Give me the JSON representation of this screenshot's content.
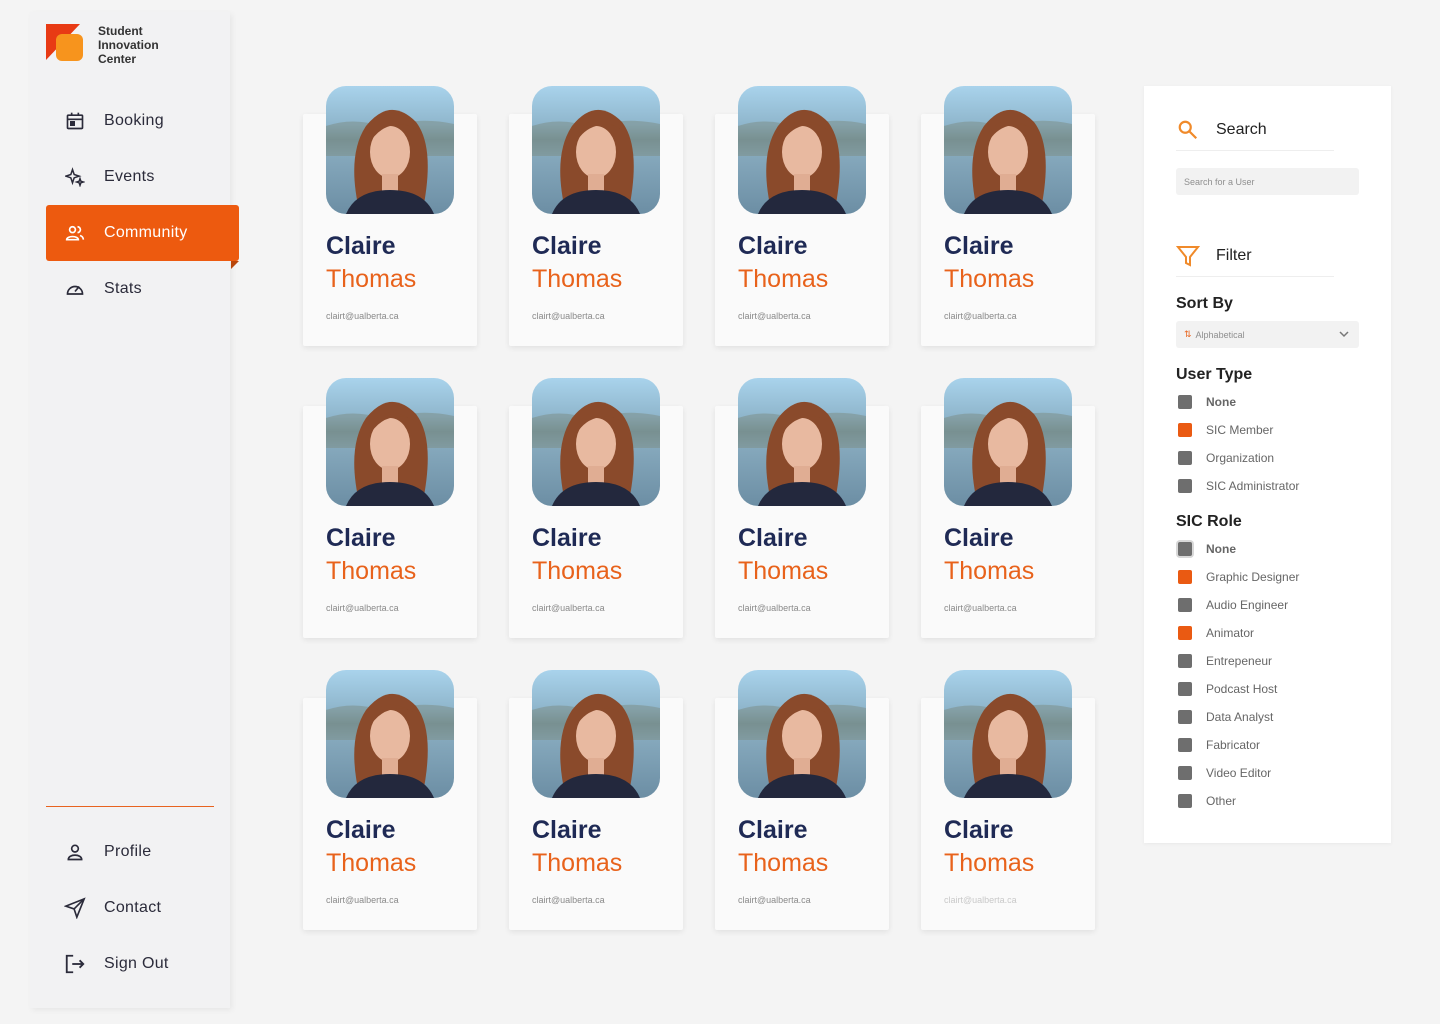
{
  "brand": {
    "name_lines": [
      "Student",
      "Innovation",
      "Center"
    ]
  },
  "nav": {
    "top": [
      {
        "label": "Booking",
        "icon": "calendar-icon",
        "active": false
      },
      {
        "label": "Events",
        "icon": "sparkle-icon",
        "active": false
      },
      {
        "label": "Community",
        "icon": "people-icon",
        "active": true
      },
      {
        "label": "Stats",
        "icon": "gauge-icon",
        "active": false
      }
    ],
    "bottom": [
      {
        "label": "Profile",
        "icon": "person-icon"
      },
      {
        "label": "Contact",
        "icon": "send-icon"
      },
      {
        "label": "Sign Out",
        "icon": "sign-out-icon"
      }
    ]
  },
  "users": [
    {
      "first": "Claire",
      "last": "Thomas",
      "email": "clairt@ualberta.ca"
    },
    {
      "first": "Claire",
      "last": "Thomas",
      "email": "clairt@ualberta.ca"
    },
    {
      "first": "Claire",
      "last": "Thomas",
      "email": "clairt@ualberta.ca"
    },
    {
      "first": "Claire",
      "last": "Thomas",
      "email": "clairt@ualberta.ca"
    },
    {
      "first": "Claire",
      "last": "Thomas",
      "email": "clairt@ualberta.ca"
    },
    {
      "first": "Claire",
      "last": "Thomas",
      "email": "clairt@ualberta.ca"
    },
    {
      "first": "Claire",
      "last": "Thomas",
      "email": "clairt@ualberta.ca"
    },
    {
      "first": "Claire",
      "last": "Thomas",
      "email": "clairt@ualberta.ca"
    },
    {
      "first": "Claire",
      "last": "Thomas",
      "email": "clairt@ualberta.ca"
    },
    {
      "first": "Claire",
      "last": "Thomas",
      "email": "clairt@ualberta.ca"
    },
    {
      "first": "Claire",
      "last": "Thomas",
      "email": "clairt@ualberta.ca"
    },
    {
      "first": "Claire",
      "last": "Thomas",
      "email": "clairt@ualberta.ca"
    }
  ],
  "panel": {
    "search_title": "Search",
    "search_placeholder": "Search for a User",
    "filter_title": "Filter",
    "sort_by_title": "Sort By",
    "sort_value": "Alphabetical",
    "user_type_title": "User Type",
    "user_types": [
      {
        "label": "None",
        "checked": false,
        "bold": true
      },
      {
        "label": "SIC Member",
        "checked": true,
        "bold": false
      },
      {
        "label": "Organization",
        "checked": false,
        "bold": false
      },
      {
        "label": "SIC Administrator",
        "checked": false,
        "bold": false
      }
    ],
    "sic_role_title": "SIC Role",
    "sic_roles": [
      {
        "label": "None",
        "checked": false,
        "bold": true
      },
      {
        "label": "Graphic Designer",
        "checked": true,
        "bold": false
      },
      {
        "label": "Audio Engineer",
        "checked": false,
        "bold": false
      },
      {
        "label": "Animator",
        "checked": true,
        "bold": false
      },
      {
        "label": "Entrepeneur",
        "checked": false,
        "bold": false
      },
      {
        "label": "Podcast Host",
        "checked": false,
        "bold": false
      },
      {
        "label": "Data Analyst",
        "checked": false,
        "bold": false
      },
      {
        "label": "Fabricator",
        "checked": false,
        "bold": false
      },
      {
        "label": "Video Editor",
        "checked": false,
        "bold": false
      },
      {
        "label": "Other",
        "checked": false,
        "bold": false
      }
    ]
  },
  "colors": {
    "accent": "#ed5a0f",
    "navy": "#1f2a55",
    "accent_text": "#e8621b"
  }
}
